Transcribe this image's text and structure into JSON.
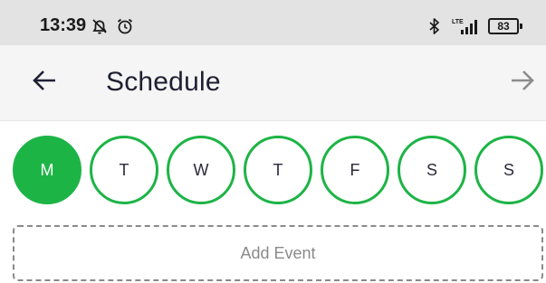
{
  "status_bar": {
    "time": "13:39",
    "battery": "83",
    "network": "LTE",
    "icons": [
      "notifications-off-icon",
      "alarm-icon",
      "bluetooth-icon",
      "signal-icon",
      "battery-icon"
    ]
  },
  "app_bar": {
    "title": "Schedule",
    "back_icon": "arrow-left-icon",
    "forward_icon": "arrow-right-icon"
  },
  "days": [
    {
      "label": "M",
      "selected": true
    },
    {
      "label": "T",
      "selected": false
    },
    {
      "label": "W",
      "selected": false
    },
    {
      "label": "T",
      "selected": false
    },
    {
      "label": "F",
      "selected": false
    },
    {
      "label": "S",
      "selected": false
    },
    {
      "label": "S",
      "selected": false
    }
  ],
  "add_event": {
    "label": "Add Event"
  },
  "colors": {
    "accent": "#1db446",
    "title": "#1f1f33",
    "muted": "#8a8a8a",
    "status_bar": "#e3e3e3",
    "app_bar": "#f5f5f5"
  }
}
